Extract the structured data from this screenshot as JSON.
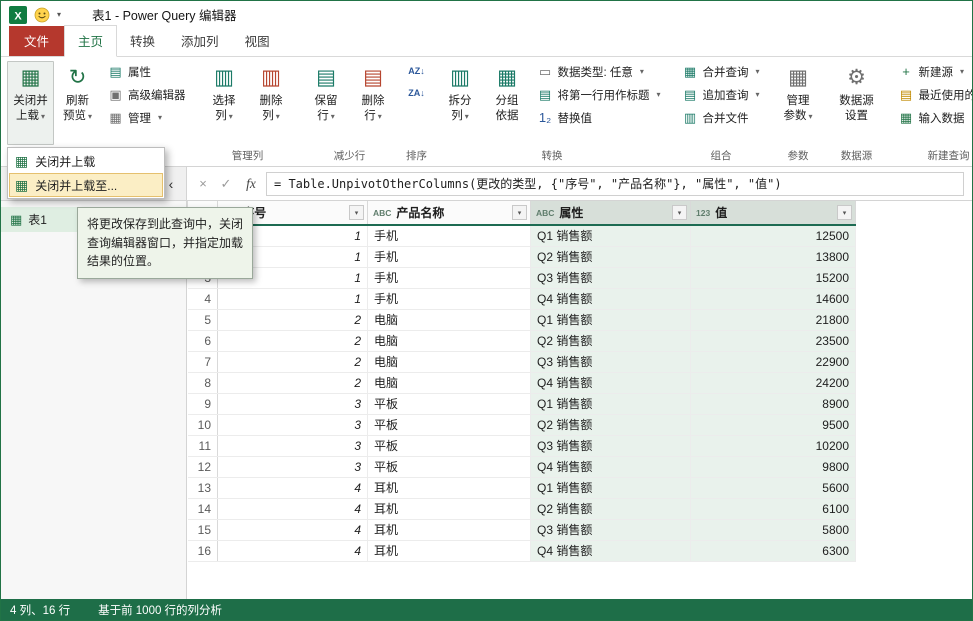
{
  "icons": {
    "caret": "▾",
    "filter": "▾",
    "collapse_pane": "‹",
    "cancel": "×",
    "check": "✓",
    "fx": "fx",
    "table": "▦",
    "rows": "▤",
    "columns": "▥",
    "box": "▣",
    "rect": "▭",
    "gear": "⚙",
    "refresh": "↻",
    "sort_asc": "AZ↓",
    "sort_desc": "ZA↓",
    "replace": "1₂",
    "plus": "+",
    "corner": "▦"
  },
  "titlebar": {
    "title": "表1 - Power Query 编辑器"
  },
  "tabs": {
    "file": "文件",
    "home": "主页",
    "transform": "转换",
    "add_column": "添加列",
    "view": "视图"
  },
  "ribbon": {
    "close_load": {
      "l1": "关闭并",
      "l2": "上载"
    },
    "refresh": {
      "l1": "刷新",
      "l2": "预览"
    },
    "properties": "属性",
    "advanced_editor": "高级编辑器",
    "manage": "管理",
    "choose_columns": {
      "l1": "选择",
      "l2": "列"
    },
    "remove_columns": {
      "l1": "删除",
      "l2": "列"
    },
    "keep_rows": {
      "l1": "保留",
      "l2": "行"
    },
    "remove_rows": {
      "l1": "删除",
      "l2": "行"
    },
    "split_column": {
      "l1": "拆分",
      "l2": "列"
    },
    "group_by": {
      "l1": "分组",
      "l2": "依据"
    },
    "data_type": "数据类型: 任意",
    "first_row_headers": "将第一行用作标题",
    "replace_values": "替换值",
    "merge_queries": "合并查询",
    "append_queries": "追加查询",
    "combine_files": "合并文件",
    "manage_parameters": {
      "l1": "管理",
      "l2": "参数"
    },
    "data_source_settings": {
      "l1": "数据源",
      "l2": "设置"
    },
    "new_source": "新建源",
    "recent_sources": "最近使用的源",
    "enter_data": "输入数据",
    "groups": {
      "manage_columns": "管理列",
      "reduce_rows": "减少行",
      "sort": "排序",
      "transform": "转换",
      "combine": "组合",
      "parameters": "参数",
      "data_sources": "数据源",
      "new_query": "新建查询"
    }
  },
  "menu": {
    "items": [
      {
        "label": "关闭并上载"
      },
      {
        "label": "关闭并上载至..."
      }
    ]
  },
  "tooltip": "将更改保存到此查询中，关闭查询编辑器窗口，并指定加载结果的位置。",
  "queries_pane": {
    "items": [
      {
        "label": "表1"
      }
    ]
  },
  "formula_bar": {
    "formula": "= Table.UnpivotOtherColumns(更改的类型, {\"序号\", \"产品名称\"}, \"属性\", \"值\")"
  },
  "table": {
    "columns": [
      {
        "type": "123",
        "name": "序号",
        "selected": false,
        "align": "right",
        "italic": true
      },
      {
        "type": "ABC",
        "name": "产品名称",
        "selected": false,
        "align": "left",
        "italic": false
      },
      {
        "type": "ABC",
        "name": "属性",
        "selected": true,
        "align": "left",
        "italic": false
      },
      {
        "type": "123",
        "name": "值",
        "selected": true,
        "align": "right",
        "italic": false
      }
    ],
    "rows": [
      {
        "num": 1,
        "cells": [
          "1",
          "手机",
          "Q1 销售额",
          "12500"
        ]
      },
      {
        "num": 2,
        "cells": [
          "1",
          "手机",
          "Q2 销售额",
          "13800"
        ]
      },
      {
        "num": 3,
        "cells": [
          "1",
          "手机",
          "Q3 销售额",
          "15200"
        ]
      },
      {
        "num": 4,
        "cells": [
          "1",
          "手机",
          "Q4 销售额",
          "14600"
        ]
      },
      {
        "num": 5,
        "cells": [
          "2",
          "电脑",
          "Q1 销售额",
          "21800"
        ]
      },
      {
        "num": 6,
        "cells": [
          "2",
          "电脑",
          "Q2 销售额",
          "23500"
        ]
      },
      {
        "num": 7,
        "cells": [
          "2",
          "电脑",
          "Q3 销售额",
          "22900"
        ]
      },
      {
        "num": 8,
        "cells": [
          "2",
          "电脑",
          "Q4 销售额",
          "24200"
        ]
      },
      {
        "num": 9,
        "cells": [
          "3",
          "平板",
          "Q1 销售额",
          "8900"
        ]
      },
      {
        "num": 10,
        "cells": [
          "3",
          "平板",
          "Q2 销售额",
          "9500"
        ]
      },
      {
        "num": 11,
        "cells": [
          "3",
          "平板",
          "Q3 销售额",
          "10200"
        ]
      },
      {
        "num": 12,
        "cells": [
          "3",
          "平板",
          "Q4 销售额",
          "9800"
        ]
      },
      {
        "num": 13,
        "cells": [
          "4",
          "耳机",
          "Q1 销售额",
          "5600"
        ]
      },
      {
        "num": 14,
        "cells": [
          "4",
          "耳机",
          "Q2 销售额",
          "6100"
        ]
      },
      {
        "num": 15,
        "cells": [
          "4",
          "耳机",
          "Q3 销售额",
          "5800"
        ]
      },
      {
        "num": 16,
        "cells": [
          "4",
          "耳机",
          "Q4 销售额",
          "6300"
        ]
      }
    ]
  },
  "status_bar": {
    "columns_rows": "4 列、16 行",
    "profile": "基于前 1000 行的列分析"
  }
}
